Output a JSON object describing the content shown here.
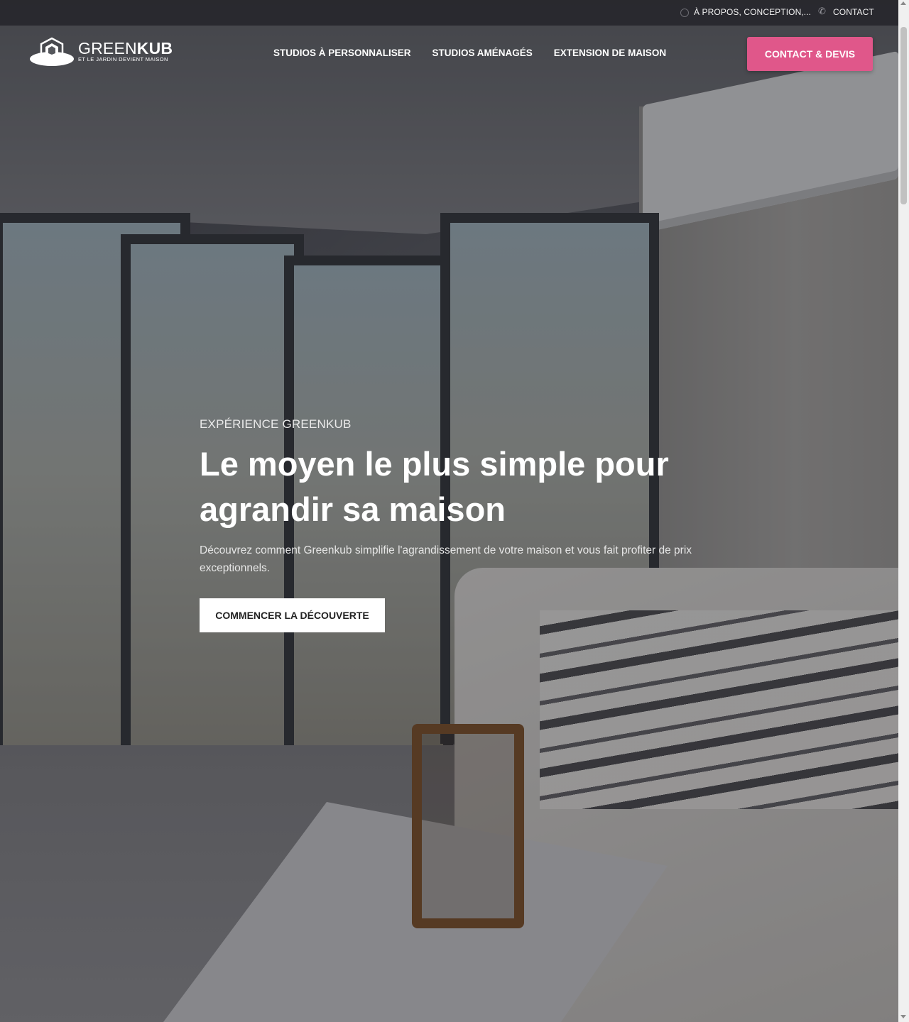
{
  "topbar": {
    "about_link": "À PROPOS, CONCEPTION,...",
    "contact_link": "CONTACT",
    "contact_icon": "phone-icon"
  },
  "header": {
    "logo_brand_light": "GREEN",
    "logo_brand_bold": "KUB",
    "logo_tagline": "ET LE JARDIN DEVIENT MAISON",
    "nav": [
      {
        "label": "STUDIOS À PERSONNALISER"
      },
      {
        "label": "STUDIOS AMÉNAGÉS"
      },
      {
        "label": "EXTENSION DE MAISON"
      }
    ],
    "cta_label": "CONTACT & DEVIS",
    "cta_color": "#e0578a"
  },
  "hero": {
    "eyebrow": "EXPÉRIENCE GREENKUB",
    "headline": "Le moyen le plus simple pour agrandir sa maison",
    "subtext": "Découvrez comment Greenkub simplifie l'agrandissement de votre maison et vous fait profiter de prix exceptionnels.",
    "button_label": "COMMENCER LA DÉCOUVERTE"
  }
}
